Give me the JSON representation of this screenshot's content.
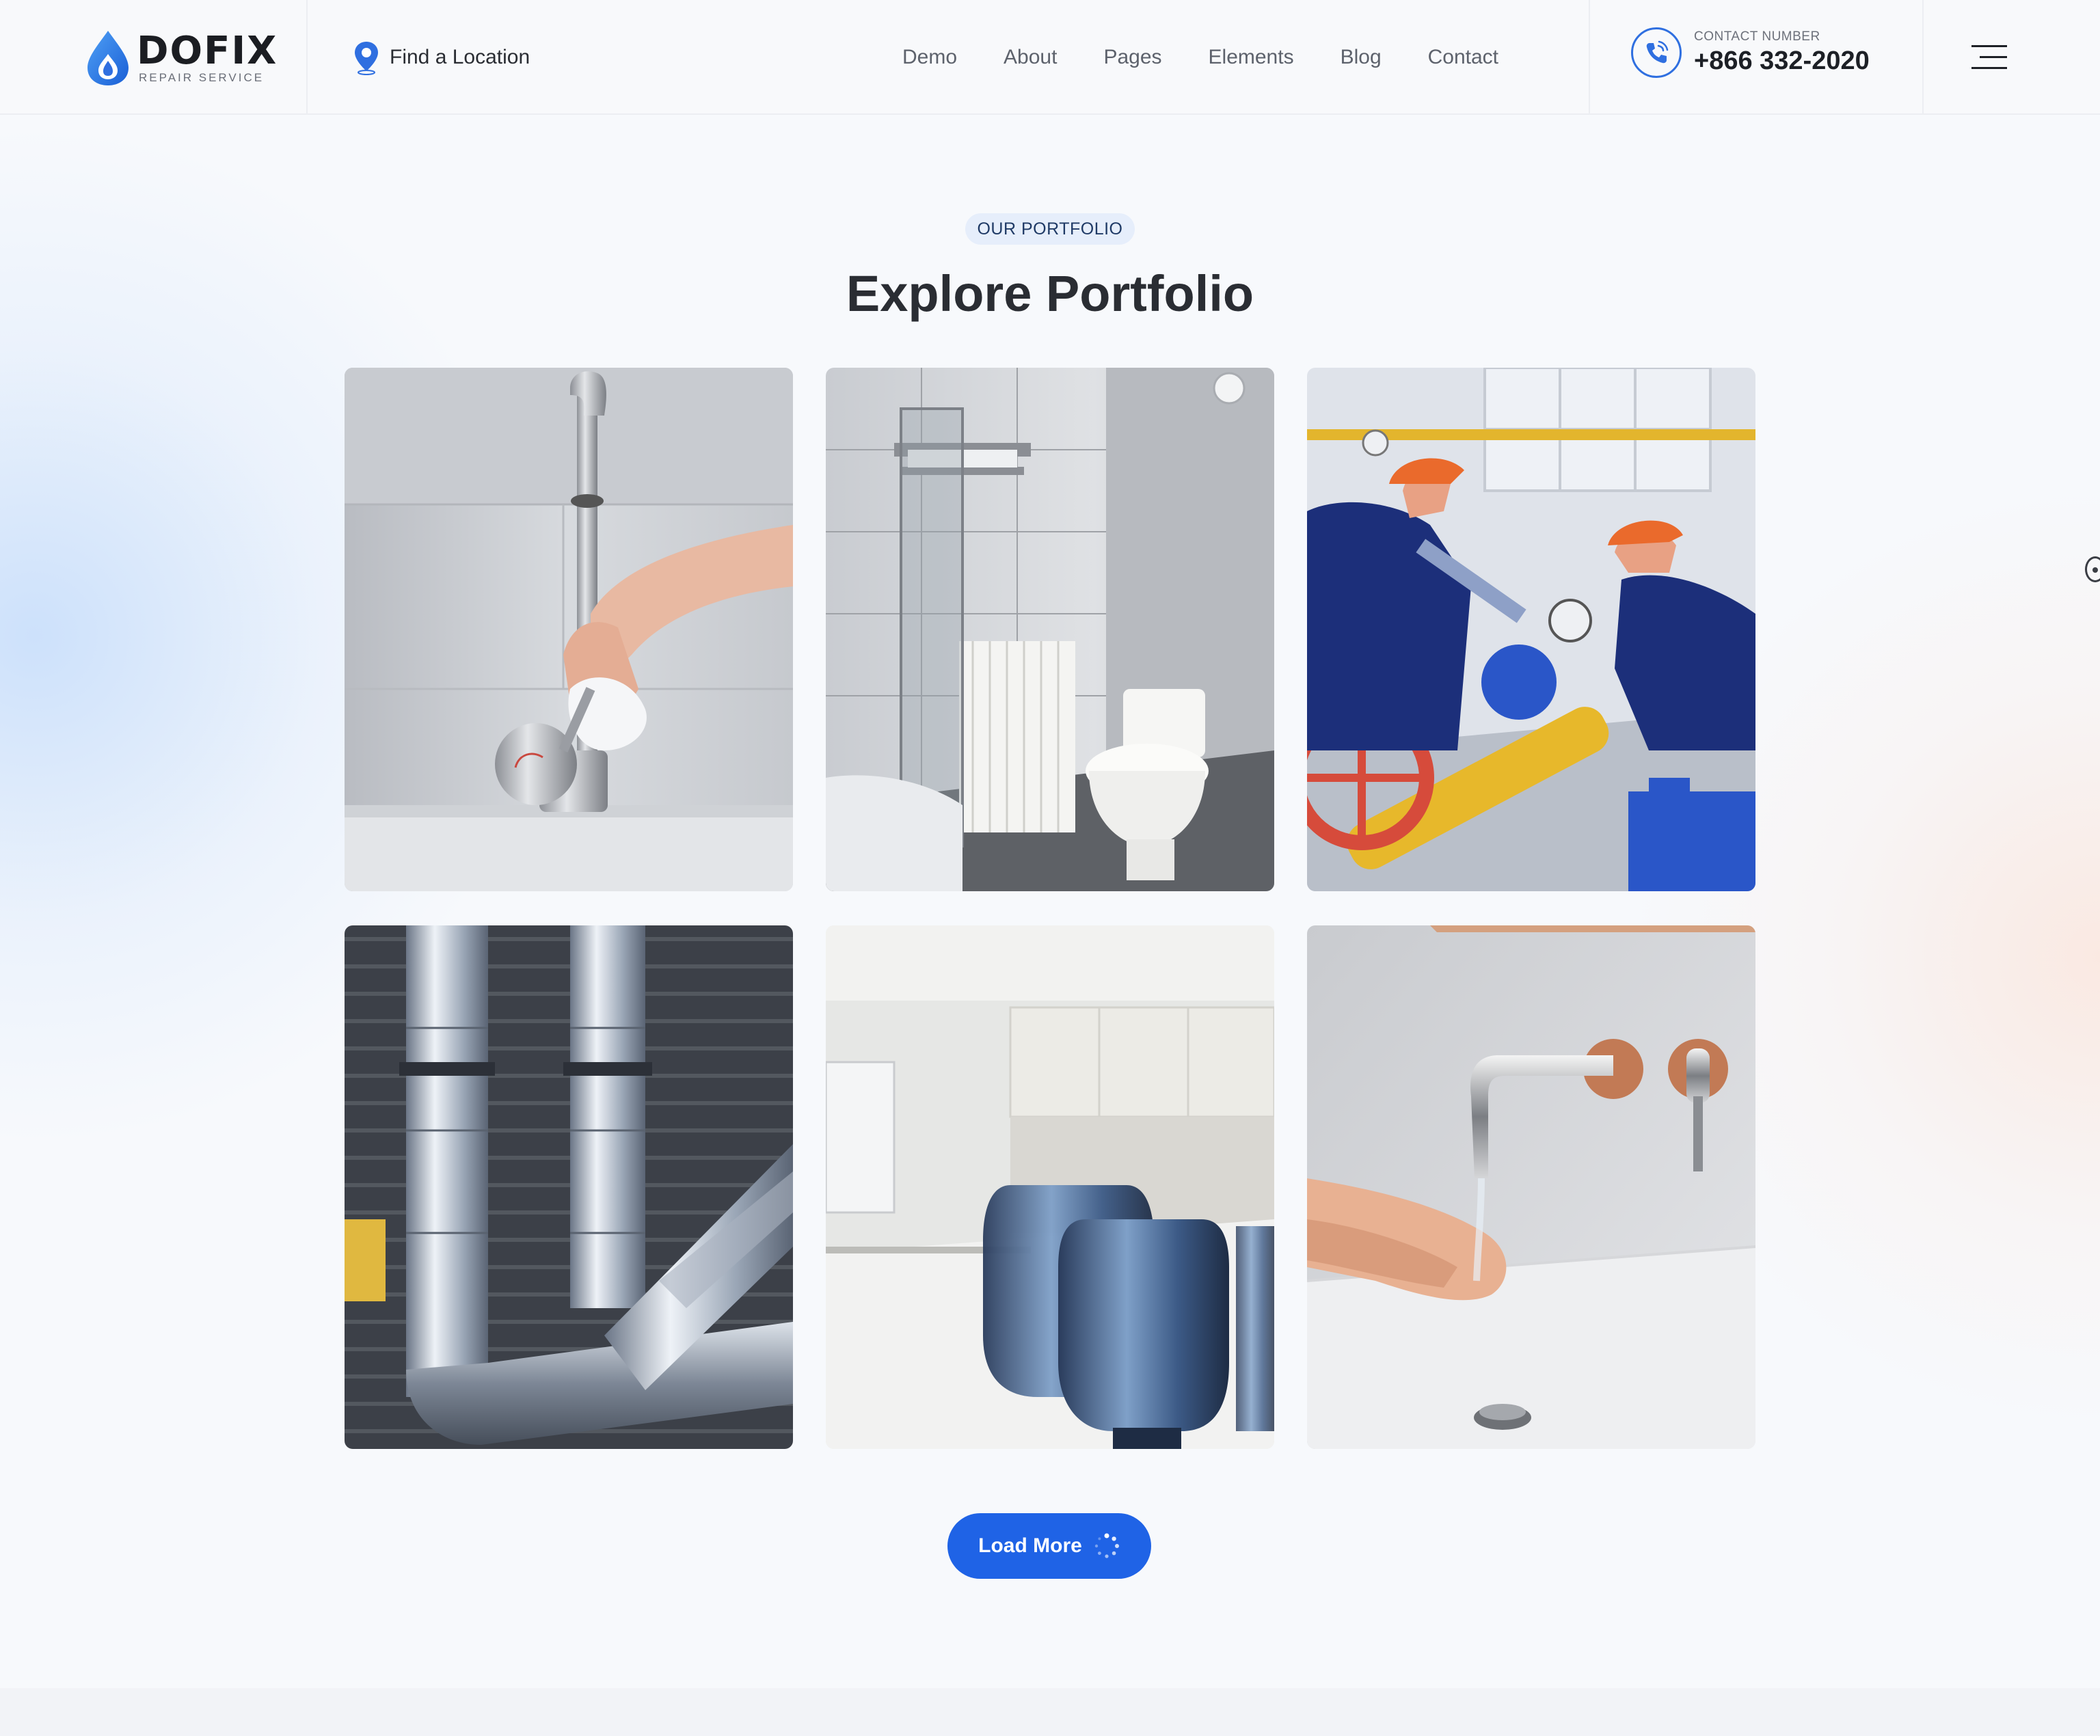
{
  "brand": {
    "name": "DOFIX",
    "tagline": "REPAIR SERVICE"
  },
  "header": {
    "find_location": "Find a Location",
    "nav": [
      "Demo",
      "About",
      "Pages",
      "Elements",
      "Blog",
      "Contact"
    ],
    "contact_label": "CONTACT NUMBER",
    "contact_phone": "+866 332-2020"
  },
  "section": {
    "badge": "OUR PORTFOLIO",
    "title": "Explore Portfolio"
  },
  "portfolio": {
    "items": [
      {
        "name": "faucet-cleaning-photo"
      },
      {
        "name": "bathroom-toilet-photo"
      },
      {
        "name": "pipeline-workers-photo"
      },
      {
        "name": "steel-ducts-photo"
      },
      {
        "name": "water-jugs-kitchen-photo"
      },
      {
        "name": "hand-washing-photo"
      }
    ],
    "load_more": "Load More"
  },
  "colors": {
    "accent": "#1f63e6",
    "badge_bg": "#e6eefb",
    "heading": "#2a2d33"
  },
  "icons": {
    "logo": "water-drop-icon",
    "location": "map-pin-icon",
    "phone": "phone-ringing-icon",
    "menu": "hamburger-menu-icon",
    "loading": "spinner-icon"
  }
}
